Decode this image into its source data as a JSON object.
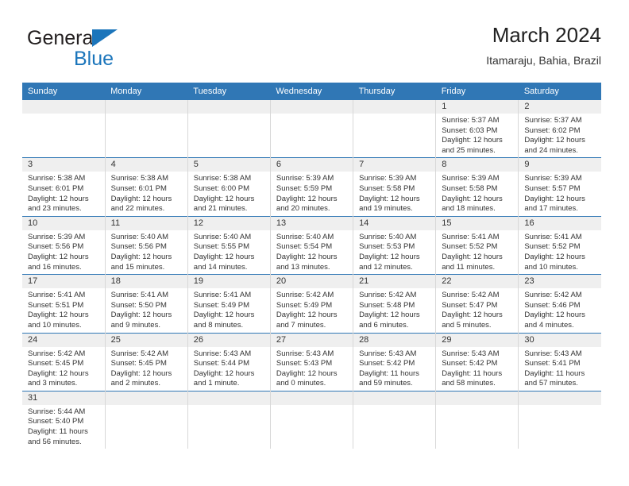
{
  "brand": {
    "word1": "General",
    "word2": "Blue",
    "triangle_color": "#1b75bb"
  },
  "header": {
    "title": "March 2024",
    "subtitle": "Itamaraju, Bahia, Brazil",
    "accent_color": "#3077b5",
    "daystrip_color": "#efefef"
  },
  "weekday_headers": [
    "Sunday",
    "Monday",
    "Tuesday",
    "Wednesday",
    "Thursday",
    "Friday",
    "Saturday"
  ],
  "labels": {
    "sunrise": "Sunrise:",
    "sunset": "Sunset:",
    "daylight": "Daylight:"
  },
  "weeks": [
    [
      {
        "day": ""
      },
      {
        "day": ""
      },
      {
        "day": ""
      },
      {
        "day": ""
      },
      {
        "day": ""
      },
      {
        "day": "1",
        "sunrise": "Sunrise: 5:37 AM",
        "sunset": "Sunset: 6:03 PM",
        "daylight1": "Daylight: 12 hours",
        "daylight2": "and 25 minutes."
      },
      {
        "day": "2",
        "sunrise": "Sunrise: 5:37 AM",
        "sunset": "Sunset: 6:02 PM",
        "daylight1": "Daylight: 12 hours",
        "daylight2": "and 24 minutes."
      }
    ],
    [
      {
        "day": "3",
        "sunrise": "Sunrise: 5:38 AM",
        "sunset": "Sunset: 6:01 PM",
        "daylight1": "Daylight: 12 hours",
        "daylight2": "and 23 minutes."
      },
      {
        "day": "4",
        "sunrise": "Sunrise: 5:38 AM",
        "sunset": "Sunset: 6:01 PM",
        "daylight1": "Daylight: 12 hours",
        "daylight2": "and 22 minutes."
      },
      {
        "day": "5",
        "sunrise": "Sunrise: 5:38 AM",
        "sunset": "Sunset: 6:00 PM",
        "daylight1": "Daylight: 12 hours",
        "daylight2": "and 21 minutes."
      },
      {
        "day": "6",
        "sunrise": "Sunrise: 5:39 AM",
        "sunset": "Sunset: 5:59 PM",
        "daylight1": "Daylight: 12 hours",
        "daylight2": "and 20 minutes."
      },
      {
        "day": "7",
        "sunrise": "Sunrise: 5:39 AM",
        "sunset": "Sunset: 5:58 PM",
        "daylight1": "Daylight: 12 hours",
        "daylight2": "and 19 minutes."
      },
      {
        "day": "8",
        "sunrise": "Sunrise: 5:39 AM",
        "sunset": "Sunset: 5:58 PM",
        "daylight1": "Daylight: 12 hours",
        "daylight2": "and 18 minutes."
      },
      {
        "day": "9",
        "sunrise": "Sunrise: 5:39 AM",
        "sunset": "Sunset: 5:57 PM",
        "daylight1": "Daylight: 12 hours",
        "daylight2": "and 17 minutes."
      }
    ],
    [
      {
        "day": "10",
        "sunrise": "Sunrise: 5:39 AM",
        "sunset": "Sunset: 5:56 PM",
        "daylight1": "Daylight: 12 hours",
        "daylight2": "and 16 minutes."
      },
      {
        "day": "11",
        "sunrise": "Sunrise: 5:40 AM",
        "sunset": "Sunset: 5:56 PM",
        "daylight1": "Daylight: 12 hours",
        "daylight2": "and 15 minutes."
      },
      {
        "day": "12",
        "sunrise": "Sunrise: 5:40 AM",
        "sunset": "Sunset: 5:55 PM",
        "daylight1": "Daylight: 12 hours",
        "daylight2": "and 14 minutes."
      },
      {
        "day": "13",
        "sunrise": "Sunrise: 5:40 AM",
        "sunset": "Sunset: 5:54 PM",
        "daylight1": "Daylight: 12 hours",
        "daylight2": "and 13 minutes."
      },
      {
        "day": "14",
        "sunrise": "Sunrise: 5:40 AM",
        "sunset": "Sunset: 5:53 PM",
        "daylight1": "Daylight: 12 hours",
        "daylight2": "and 12 minutes."
      },
      {
        "day": "15",
        "sunrise": "Sunrise: 5:41 AM",
        "sunset": "Sunset: 5:52 PM",
        "daylight1": "Daylight: 12 hours",
        "daylight2": "and 11 minutes."
      },
      {
        "day": "16",
        "sunrise": "Sunrise: 5:41 AM",
        "sunset": "Sunset: 5:52 PM",
        "daylight1": "Daylight: 12 hours",
        "daylight2": "and 10 minutes."
      }
    ],
    [
      {
        "day": "17",
        "sunrise": "Sunrise: 5:41 AM",
        "sunset": "Sunset: 5:51 PM",
        "daylight1": "Daylight: 12 hours",
        "daylight2": "and 10 minutes."
      },
      {
        "day": "18",
        "sunrise": "Sunrise: 5:41 AM",
        "sunset": "Sunset: 5:50 PM",
        "daylight1": "Daylight: 12 hours",
        "daylight2": "and 9 minutes."
      },
      {
        "day": "19",
        "sunrise": "Sunrise: 5:41 AM",
        "sunset": "Sunset: 5:49 PM",
        "daylight1": "Daylight: 12 hours",
        "daylight2": "and 8 minutes."
      },
      {
        "day": "20",
        "sunrise": "Sunrise: 5:42 AM",
        "sunset": "Sunset: 5:49 PM",
        "daylight1": "Daylight: 12 hours",
        "daylight2": "and 7 minutes."
      },
      {
        "day": "21",
        "sunrise": "Sunrise: 5:42 AM",
        "sunset": "Sunset: 5:48 PM",
        "daylight1": "Daylight: 12 hours",
        "daylight2": "and 6 minutes."
      },
      {
        "day": "22",
        "sunrise": "Sunrise: 5:42 AM",
        "sunset": "Sunset: 5:47 PM",
        "daylight1": "Daylight: 12 hours",
        "daylight2": "and 5 minutes."
      },
      {
        "day": "23",
        "sunrise": "Sunrise: 5:42 AM",
        "sunset": "Sunset: 5:46 PM",
        "daylight1": "Daylight: 12 hours",
        "daylight2": "and 4 minutes."
      }
    ],
    [
      {
        "day": "24",
        "sunrise": "Sunrise: 5:42 AM",
        "sunset": "Sunset: 5:45 PM",
        "daylight1": "Daylight: 12 hours",
        "daylight2": "and 3 minutes."
      },
      {
        "day": "25",
        "sunrise": "Sunrise: 5:42 AM",
        "sunset": "Sunset: 5:45 PM",
        "daylight1": "Daylight: 12 hours",
        "daylight2": "and 2 minutes."
      },
      {
        "day": "26",
        "sunrise": "Sunrise: 5:43 AM",
        "sunset": "Sunset: 5:44 PM",
        "daylight1": "Daylight: 12 hours",
        "daylight2": "and 1 minute."
      },
      {
        "day": "27",
        "sunrise": "Sunrise: 5:43 AM",
        "sunset": "Sunset: 5:43 PM",
        "daylight1": "Daylight: 12 hours",
        "daylight2": "and 0 minutes."
      },
      {
        "day": "28",
        "sunrise": "Sunrise: 5:43 AM",
        "sunset": "Sunset: 5:42 PM",
        "daylight1": "Daylight: 11 hours",
        "daylight2": "and 59 minutes."
      },
      {
        "day": "29",
        "sunrise": "Sunrise: 5:43 AM",
        "sunset": "Sunset: 5:42 PM",
        "daylight1": "Daylight: 11 hours",
        "daylight2": "and 58 minutes."
      },
      {
        "day": "30",
        "sunrise": "Sunrise: 5:43 AM",
        "sunset": "Sunset: 5:41 PM",
        "daylight1": "Daylight: 11 hours",
        "daylight2": "and 57 minutes."
      }
    ],
    [
      {
        "day": "31",
        "sunrise": "Sunrise: 5:44 AM",
        "sunset": "Sunset: 5:40 PM",
        "daylight1": "Daylight: 11 hours",
        "daylight2": "and 56 minutes."
      },
      {
        "day": ""
      },
      {
        "day": ""
      },
      {
        "day": ""
      },
      {
        "day": ""
      },
      {
        "day": ""
      },
      {
        "day": ""
      }
    ]
  ]
}
